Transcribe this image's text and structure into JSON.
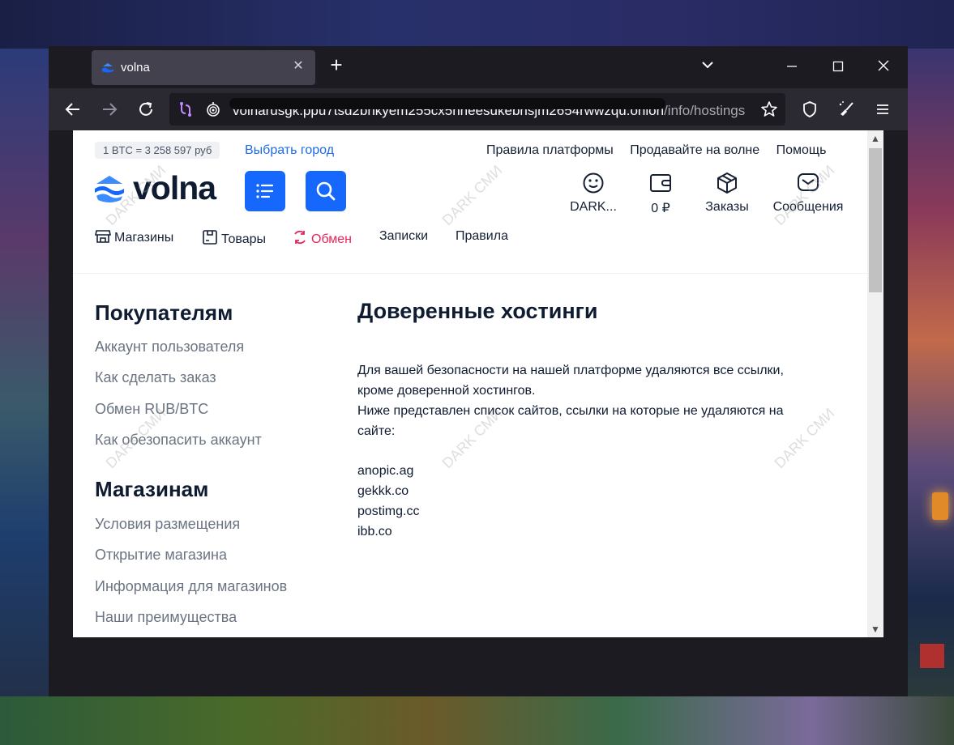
{
  "browser": {
    "tab_title": "volna",
    "new_tab_symbol": "+",
    "url_suffix": "/info/hostings",
    "url_prefix": "volnarusgk.ppu7tsd2bhkyem255cx5hneesukebhsjm2654rwwzqu.onion"
  },
  "header": {
    "rate": "1 BTC = 3 258 597 руб",
    "city_link": "Выбрать город",
    "top_links": [
      "Правила платформы",
      "Продавайте на волне",
      "Помощь"
    ],
    "logo_text": "volna",
    "actions": [
      {
        "label": "DARK...",
        "icon": "smiley-icon"
      },
      {
        "label": "0 ₽",
        "icon": "wallet-icon"
      },
      {
        "label": "Заказы",
        "icon": "box-icon"
      },
      {
        "label": "Сообщения",
        "icon": "message-icon"
      }
    ]
  },
  "nav": {
    "items": [
      "Магазины",
      "Товары",
      "Обмен",
      "Записки",
      "Правила"
    ],
    "active": "Обмен"
  },
  "sidebar": {
    "buyers_title": "Покупателям",
    "buyers_links": [
      "Аккаунт пользователя",
      "Как сделать заказ",
      "Обмен RUB/BTC",
      "Как обезопасить аккаунт"
    ],
    "shops_title": "Магазинам",
    "shops_links": [
      "Условия размещения",
      "Открытие магазина",
      "Информация для магазинов",
      "Наши преимущества"
    ]
  },
  "main": {
    "title": "Доверенные хостинги",
    "paragraph1_line1": "Для вашей безопасности на нашей платформе удаляются все ссылки,",
    "paragraph1_line2": "кроме доверенной хостингов.",
    "paragraph2_line1": "Ниже представлен список сайтов, ссылки на которые не удаляются на",
    "paragraph2_line2": "сайте:",
    "hostings": [
      "anopic.ag",
      "gekkk.co",
      "postimg.cc",
      "ibb.co"
    ]
  },
  "watermark": "DARK СМИ",
  "colors": {
    "brand_blue": "#1568fb",
    "active_nav": "#e8245a",
    "text_dark": "#0f1b31",
    "link_gray": "#6b7482"
  }
}
